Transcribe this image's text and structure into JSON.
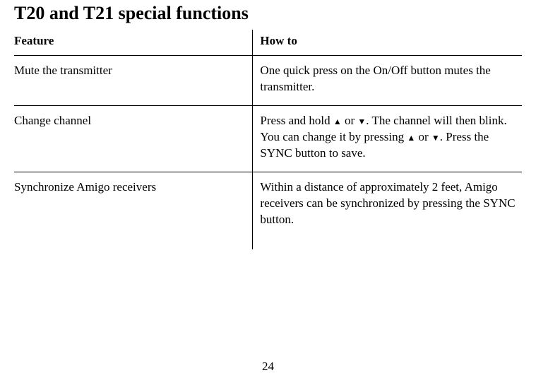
{
  "title": "T20 and T21 special functions",
  "headers": {
    "feature": "Feature",
    "howto": "How to"
  },
  "rows": [
    {
      "feature": "Mute the transmitter",
      "howto_parts": [
        "One quick press on the On/Off button mutes the transmitter."
      ]
    },
    {
      "feature": "Change channel",
      "howto_parts": [
        "Press and hold ",
        "▲",
        " or ",
        "▼",
        ". The channel will then blink. You can change it by pressing ",
        "▲",
        " or ",
        "▼",
        ". Press the SYNC button to save."
      ]
    },
    {
      "feature": "Synchronize Amigo receivers",
      "howto_parts": [
        "Within a distance of approximately 2 feet, Amigo receivers can be synchronized by pressing the SYNC button."
      ]
    }
  ],
  "page_number": "24"
}
